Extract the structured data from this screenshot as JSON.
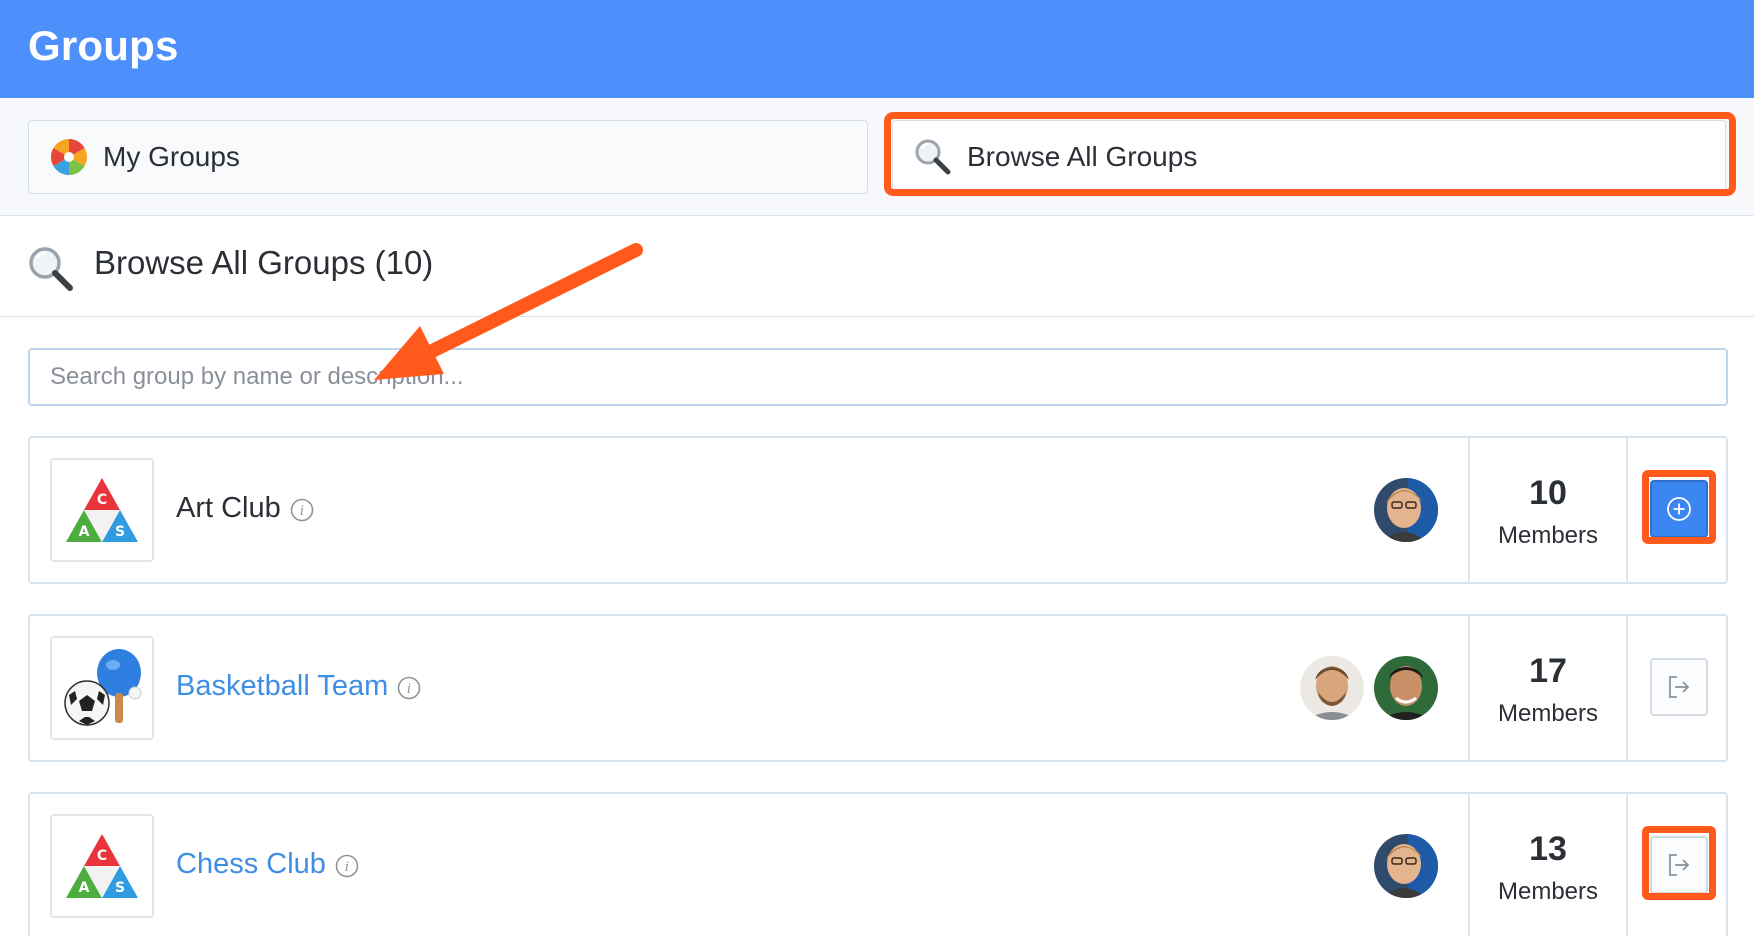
{
  "header": {
    "title": "Groups"
  },
  "tabs": {
    "my_groups": {
      "label": "My Groups",
      "icon": "groups-wheel-icon"
    },
    "browse_all": {
      "label": "Browse All Groups",
      "icon": "magnifier-icon",
      "highlighted": true
    }
  },
  "section": {
    "title": "Browse All Groups (10)",
    "icon": "magnifier-icon"
  },
  "search": {
    "placeholder": "Search group by name or description..."
  },
  "groups": [
    {
      "name": "Art Club",
      "members_count": "10",
      "members_label": "Members",
      "action": "join",
      "linked": false,
      "avatars": 1,
      "logo": "cas-triangle-logo"
    },
    {
      "name": "Basketball Team",
      "members_count": "17",
      "members_label": "Members",
      "action": "leave",
      "linked": true,
      "avatars": 2,
      "logo": "sports-balls-logo"
    },
    {
      "name": "Chess Club",
      "members_count": "13",
      "members_label": "Members",
      "action": "leave",
      "linked": true,
      "avatars": 1,
      "logo": "cas-triangle-logo"
    }
  ],
  "colors": {
    "header_bg": "#4d8ffb",
    "link": "#3f8ee6",
    "join_button": "#3c86f1",
    "annotation": "#ff5a1c"
  }
}
